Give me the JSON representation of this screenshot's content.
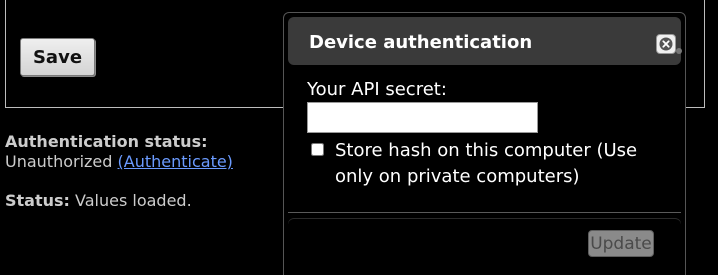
{
  "page": {
    "save_label": "Save",
    "auth_status_label": "Authentication status:",
    "auth_status_value": "Unauthorized",
    "authenticate_link": "(Authenticate)",
    "status_label": "Status:",
    "status_value": "Values loaded."
  },
  "dialog": {
    "title": "Device authentication",
    "api_secret_label": "Your API secret:",
    "api_secret_value": "",
    "store_hash_label": "Store hash on this computer (Use only on private computers)",
    "store_hash_checked": false,
    "update_label": "Update",
    "close_icon": "close-icon"
  },
  "colors": {
    "background": "#000000",
    "titlebar": "#3a3a3a",
    "link": "#6b9bff",
    "text": "#cccccc"
  }
}
